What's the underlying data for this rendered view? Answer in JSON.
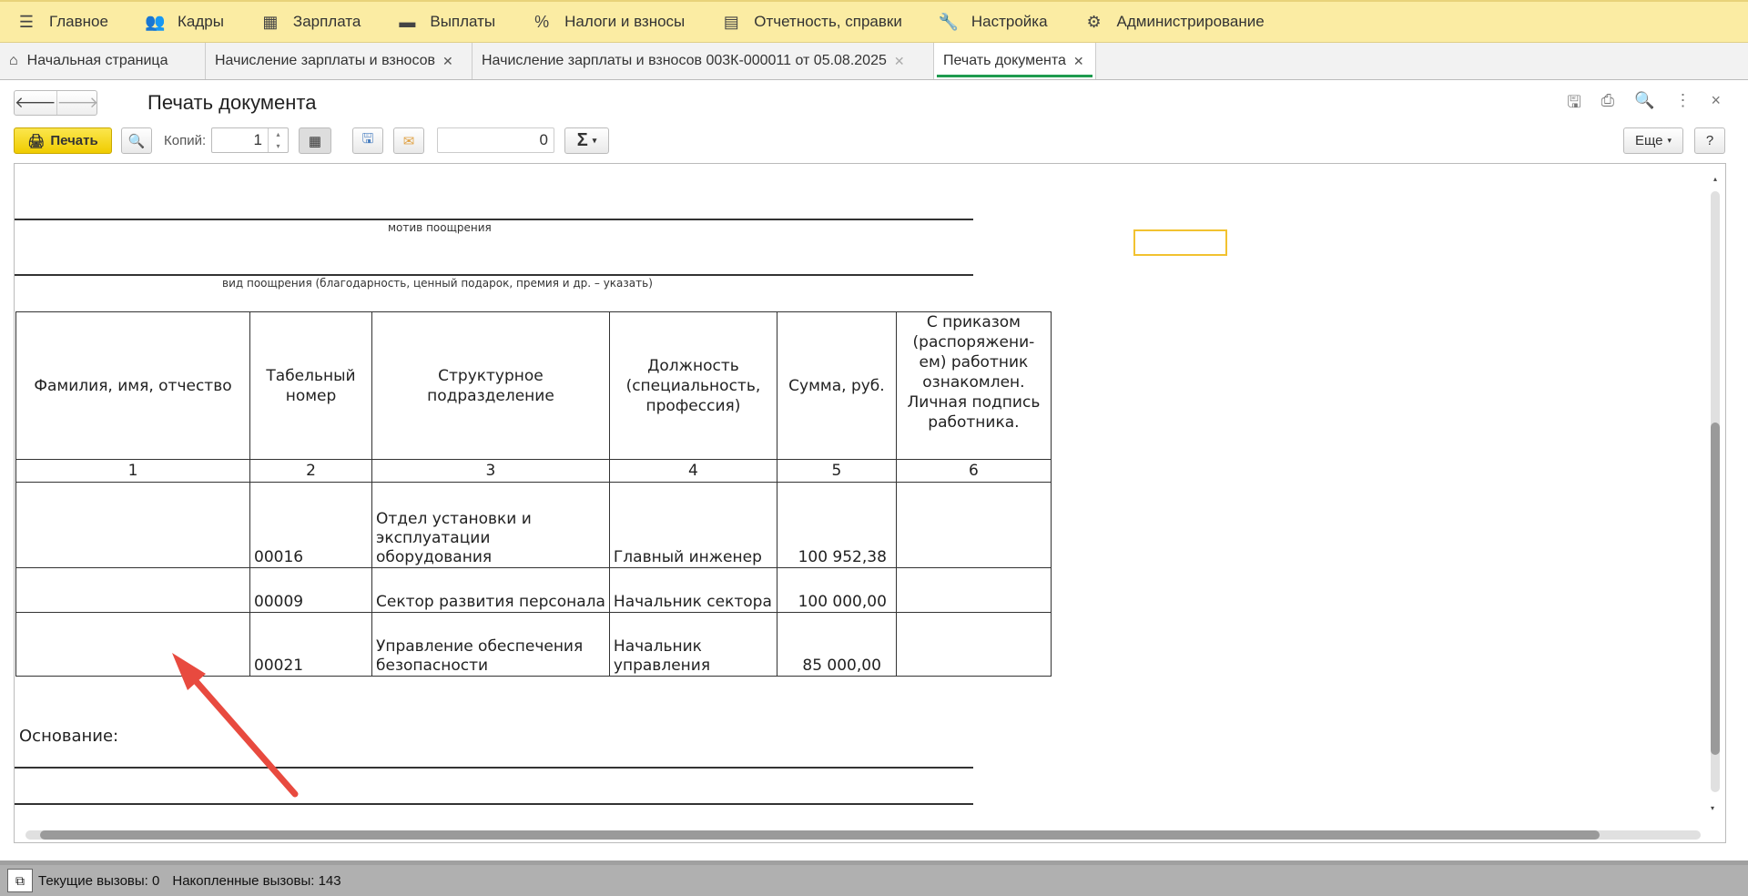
{
  "menu": [
    {
      "label": "Главное",
      "icon": "hamburger-icon"
    },
    {
      "label": "Кадры",
      "icon": "people-icon"
    },
    {
      "label": "Зарплата",
      "icon": "calculator-icon"
    },
    {
      "label": "Выплаты",
      "icon": "wallet-icon"
    },
    {
      "label": "Налоги и взносы",
      "icon": "percent-icon"
    },
    {
      "label": "Отчетность, справки",
      "icon": "reports-icon"
    },
    {
      "label": "Настройка",
      "icon": "wrench-icon"
    },
    {
      "label": "Администрирование",
      "icon": "gear-icon"
    }
  ],
  "tabs": [
    {
      "label": "Начальная страница"
    },
    {
      "label": "Начисление зарплаты и взносов"
    },
    {
      "label": "Начисление зарплаты и взносов 003К-000011 от 05.08.2025"
    },
    {
      "label": "Печать документа"
    }
  ],
  "title": "Печать документа",
  "toolbar": {
    "print": "Печать",
    "copies_label": "Копий:",
    "copies": "1",
    "sum": "0",
    "more": "Еще",
    "help": "?"
  },
  "doc": {
    "motive_caption": "мотив поощрения",
    "kind_caption": "вид поощрения (благодарность, ценный подарок, премия и др. – указать)",
    "headers": [
      "Фамилия, имя, отчество",
      "Табельный номер",
      "Структурное подразделение",
      "Должность (специальность, профессия)",
      "Сумма, руб.",
      "С приказом (распоряжени-ем) работник ознакомлен. Личная подпись работника."
    ],
    "numbers": [
      "1",
      "2",
      "3",
      "4",
      "5",
      "6"
    ],
    "rows": [
      {
        "name": "",
        "tab": "00016",
        "dept": "Отдел установки и эксплуатации оборудования",
        "pos": "Главный инженер",
        "sum": "100 952,38",
        "sign": ""
      },
      {
        "name": "",
        "tab": "00009",
        "dept": "Сектор развития персонала",
        "pos": "Начальник сектора",
        "sum": "100 000,00",
        "sign": ""
      },
      {
        "name": "",
        "tab": "00021",
        "dept": "Управление обеспечения безопасности",
        "pos": "Начальник управления",
        "sum": "85 000,00",
        "sign": ""
      }
    ],
    "basis": "Основание:"
  },
  "status": {
    "current": "Текущие вызовы: 0",
    "accumulated": "Накопленные вызовы: 143"
  }
}
